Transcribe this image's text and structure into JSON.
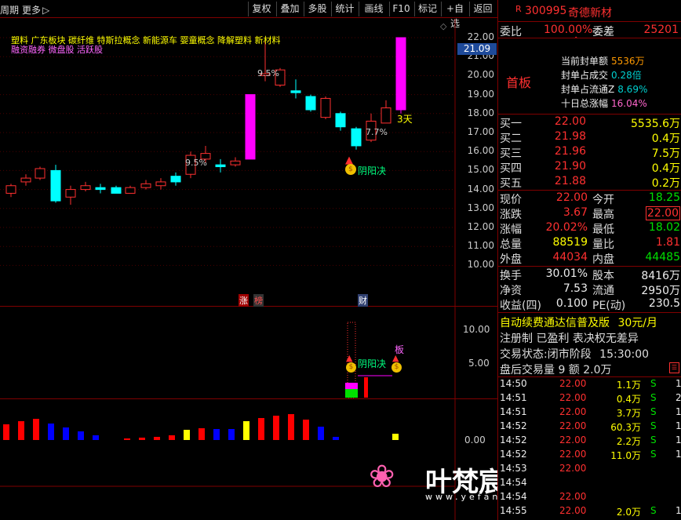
{
  "toolbar": {
    "left_label": "周期",
    "more_label": "更多",
    "more_arrow": "▷",
    "buttons": [
      "复权",
      "叠加",
      "多股",
      "统计",
      "画线",
      "F10",
      "标记",
      "+自选",
      "返回"
    ]
  },
  "price_axis": [
    "22.00",
    "21.00",
    "20.00",
    "19.00",
    "18.00",
    "17.00",
    "16.00",
    "15.00",
    "14.00",
    "13.00",
    "12.00",
    "11.00",
    "10.00"
  ],
  "current_price_tag": "21.09",
  "concepts_line1": "塑料 广东板块 碳纤维 特斯拉概念 新能源车 婴童概念 降解塑料 新材料",
  "concepts_line2": "融资融券 微盘股 活跃股",
  "chart_labels": {
    "pct1": "9.5%",
    "pct2": "9.5%",
    "pct3": "7.7%",
    "days": "3天",
    "yinyang": "阴阳决",
    "zhang": "涨",
    "bang": "榜",
    "cai": "财"
  },
  "indicator_axis": [
    "10.00",
    "5.00"
  ],
  "indicator_labels": {
    "ban": "板",
    "yinyang": "阴阳决"
  },
  "volume_axis": "0.00",
  "stock": {
    "code_prefix": "R",
    "code": "300995",
    "name": "奇德新材"
  },
  "weibi": {
    "label1": "委比",
    "val1": "100.00%",
    "label2": "委差",
    "val2": "25201"
  },
  "shouban": {
    "title": "首板",
    "rows": [
      {
        "label": "当前封单额",
        "value": "5536万"
      },
      {
        "label": "封单占成交",
        "value": "0.28倍"
      },
      {
        "label": "封单占流通Z",
        "value": "8.69%"
      },
      {
        "label": "十日总涨幅",
        "value": "16.04%"
      }
    ]
  },
  "buy_orders": [
    {
      "label": "买一",
      "price": "22.00",
      "vol": "5535.6万"
    },
    {
      "label": "买二",
      "price": "21.98",
      "vol": "0.4万"
    },
    {
      "label": "买三",
      "price": "21.96",
      "vol": "7.5万"
    },
    {
      "label": "买四",
      "price": "21.90",
      "vol": "0.4万"
    },
    {
      "label": "买五",
      "price": "21.88",
      "vol": "0.2万"
    }
  ],
  "quote": [
    {
      "l1": "现价",
      "v1": "22.00",
      "l2": "今开",
      "v2": "18.25"
    },
    {
      "l1": "涨跌",
      "v1": "3.67",
      "l2": "最高",
      "v2": "22.00"
    },
    {
      "l1": "涨幅",
      "v1": "20.02%",
      "l2": "最低",
      "v2": "18.02"
    },
    {
      "l1": "总量",
      "v1": "88519",
      "l2": "量比",
      "v2": "1.81"
    },
    {
      "l1": "外盘",
      "v1": "44034",
      "l2": "内盘",
      "v2": "44485"
    }
  ],
  "fundamentals": [
    {
      "l1": "换手",
      "v1": "30.01%",
      "l2": "股本",
      "v2": "8416万"
    },
    {
      "l1": "净资",
      "v1": "7.53",
      "l2": "流通",
      "v2": "2950万"
    },
    {
      "l1": "收益(四)",
      "v1": "0.100",
      "l2": "PE(动)",
      "v2": "230.5"
    }
  ],
  "promo": {
    "text": "自动续费通达信普及版",
    "price": "30元/月"
  },
  "info_line": "注册制 已盈利 表决权无差异",
  "trade_status": {
    "label": "交易状态:",
    "value": "闭市阶段",
    "time": "15:30:00"
  },
  "after_hours": "盘后交易量 9 额 2.0万",
  "ticks": [
    {
      "time": "14:50",
      "price": "22.00",
      "vol": "1.1万",
      "side": "S",
      "n": "1"
    },
    {
      "time": "14:51",
      "price": "22.00",
      "vol": "0.4万",
      "side": "S",
      "n": "2"
    },
    {
      "time": "14:51",
      "price": "22.00",
      "vol": "3.7万",
      "side": "S",
      "n": "1"
    },
    {
      "time": "14:52",
      "price": "22.00",
      "vol": "60.3万",
      "side": "S",
      "n": "1"
    },
    {
      "time": "14:52",
      "price": "22.00",
      "vol": "2.2万",
      "side": "S",
      "n": "1"
    },
    {
      "time": "14:52",
      "price": "22.00",
      "vol": "11.0万",
      "side": "S",
      "n": "1"
    },
    {
      "time": "14:53",
      "price": "22.00",
      "vol": "",
      "side": "",
      "n": ""
    },
    {
      "time": "14:54",
      "price": "",
      "vol": "",
      "side": "",
      "n": ""
    },
    {
      "time": "14:54",
      "price": "22.00",
      "vol": "",
      "side": "",
      "n": ""
    },
    {
      "time": "14:55",
      "price": "22.00",
      "vol": "2.0万",
      "side": "S",
      "n": "1"
    }
  ],
  "watermark": {
    "title": "叶梵宸指标公式网",
    "url": "www.yefanchen.com"
  },
  "colors": {
    "up": "#ff3030",
    "down": "#00ffff",
    "limit": "#ff00ff",
    "frame": "#800000"
  }
}
